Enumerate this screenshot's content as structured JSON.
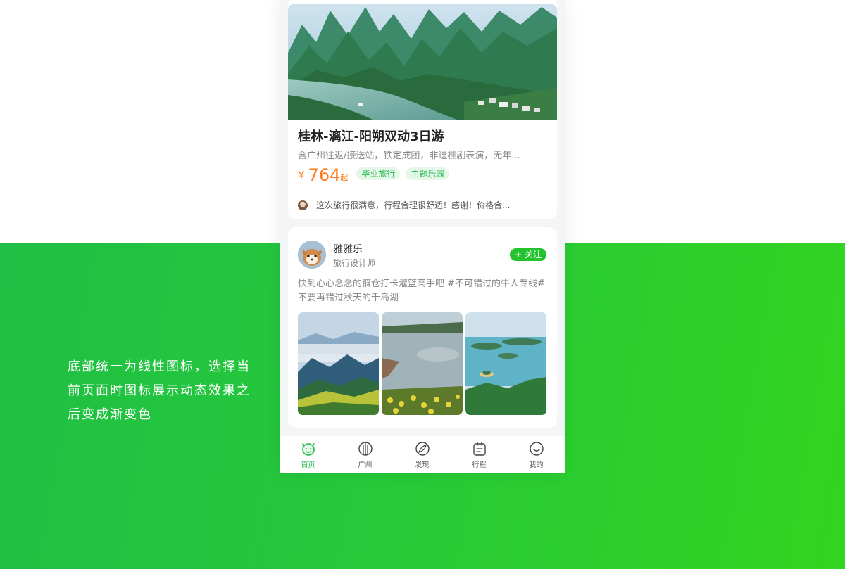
{
  "caption": {
    "lines": [
      "底部统一为线性图标，选择当前页面时图标展示动态效果之后变成渐变色"
    ]
  },
  "tour_card": {
    "title": "桂林-漓江-阳朔双动3日游",
    "description": "含广州往返/接送站，铁定成团，非遗桂剧表演，无年...",
    "price_symbol": "¥",
    "price": "764",
    "price_suffix": "起",
    "tags": [
      "毕业旅行",
      "主题乐园"
    ],
    "review": "这次旅行很满意，行程合理很舒适！感谢！价格合..."
  },
  "post_card": {
    "user_name": "雅雅乐",
    "user_role": "旅行设计师",
    "follow_label": "+ 关注",
    "text": "快到心心念念的镰仓打卡灌篮高手吧 #不可错过的牛人专线# 不要再错过秋天的千岛湖"
  },
  "tabbar": {
    "items": [
      {
        "label": "首页",
        "icon": "home-icon",
        "active": true
      },
      {
        "label": "广州",
        "icon": "city-icon",
        "active": false
      },
      {
        "label": "发现",
        "icon": "discover-icon",
        "active": false
      },
      {
        "label": "行程",
        "icon": "itinerary-icon",
        "active": false
      },
      {
        "label": "我的",
        "icon": "profile-icon",
        "active": false
      }
    ]
  },
  "colors": {
    "accent": "#22c32e",
    "price": "#ff7a1a",
    "tag_text": "#1db94a",
    "background_gradient_start": "#1fbf45",
    "background_gradient_end": "#33d41f"
  }
}
